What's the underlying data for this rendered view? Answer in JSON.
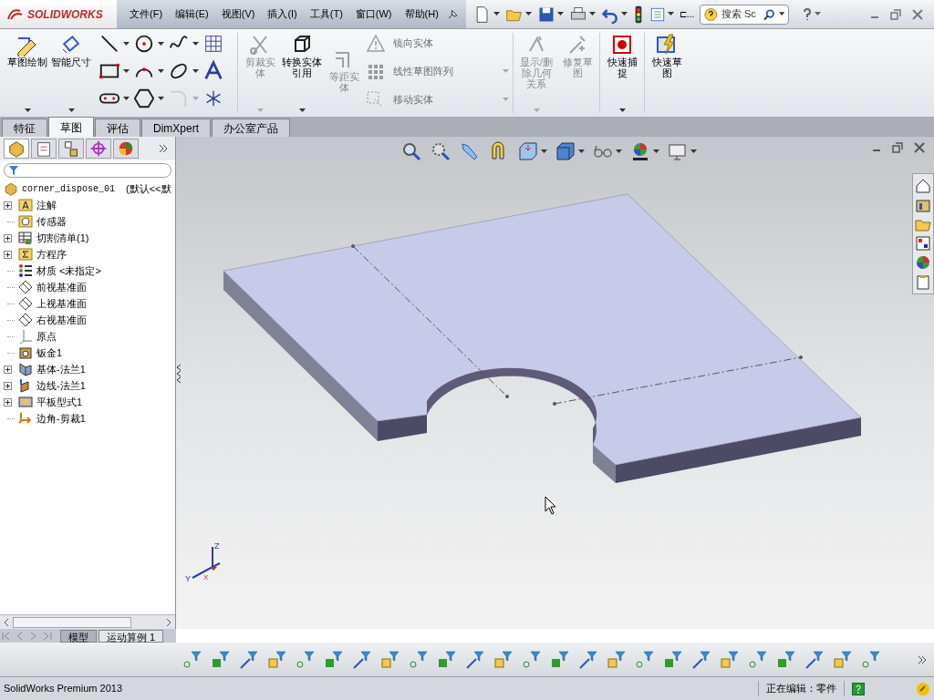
{
  "window": {
    "app_name": "SOLIDWORKS"
  },
  "menu": [
    "文件(F)",
    "编辑(E)",
    "视图(V)",
    "插入(I)",
    "工具(T)",
    "窗口(W)",
    "帮助(H)"
  ],
  "quick_toolbar": {
    "overflow": "⊏..."
  },
  "search": {
    "placeholder": "搜索 Sc"
  },
  "ribbon": {
    "sketch_large": [
      {
        "label": "草图绘制",
        "disabled": false
      },
      {
        "label": "智能尺寸",
        "disabled": false
      }
    ],
    "sketch_tools": [
      {
        "kind": "line",
        "disabled": false
      },
      {
        "kind": "circle",
        "disabled": false
      },
      {
        "kind": "spline",
        "disabled": false
      },
      {
        "kind": "grid",
        "disabled": false
      },
      {
        "kind": "rect",
        "disabled": false
      },
      {
        "kind": "arc",
        "disabled": false
      },
      {
        "kind": "ellipse",
        "disabled": false
      },
      {
        "kind": "text",
        "disabled": false
      },
      {
        "kind": "slot",
        "disabled": false
      },
      {
        "kind": "polygon",
        "disabled": false
      },
      {
        "kind": "fillet",
        "disabled": true
      },
      {
        "kind": "point",
        "disabled": false
      }
    ],
    "edit_large": [
      {
        "label": "剪裁实体",
        "disabled": true
      },
      {
        "label": "转换实体引用",
        "disabled": false
      },
      {
        "label": "等距实体",
        "disabled": true
      }
    ],
    "edit_small": [
      {
        "label": "镜向实体",
        "disabled": true
      },
      {
        "label": "线性草图阵列",
        "disabled": true
      },
      {
        "label": "移动实体",
        "disabled": true
      }
    ],
    "relation_large": [
      {
        "label": "显示/删除几何关系",
        "disabled": true
      },
      {
        "label": "修复草图",
        "disabled": true
      },
      {
        "label": "快速捕捉",
        "disabled": false
      },
      {
        "label": "快速草图",
        "disabled": false
      }
    ]
  },
  "tabs": [
    {
      "label": "特征",
      "selected": false
    },
    {
      "label": "草图",
      "selected": true
    },
    {
      "label": "评估",
      "selected": false
    },
    {
      "label": "DimXpert",
      "selected": false
    },
    {
      "label": "办公室产品",
      "selected": false
    }
  ],
  "feature_tree": {
    "root": {
      "name": "corner_dispose_01",
      "configuration": "(默认<<默"
    },
    "items": [
      {
        "kind": "annotations",
        "label": "注解",
        "expandable": true
      },
      {
        "kind": "sensors",
        "label": "传感器",
        "expandable": false
      },
      {
        "kind": "cutlist",
        "label": "切割清单(1)",
        "expandable": true
      },
      {
        "kind": "equations",
        "label": "方程序",
        "expandable": true
      },
      {
        "kind": "material",
        "label": "材质 <未指定>",
        "expandable": false
      },
      {
        "kind": "plane",
        "label": "前视基准面",
        "expandable": false
      },
      {
        "kind": "plane",
        "label": "上视基准面",
        "expandable": false
      },
      {
        "kind": "plane",
        "label": "右视基准面",
        "expandable": false
      },
      {
        "kind": "origin",
        "label": "原点",
        "expandable": false
      },
      {
        "kind": "sheetmetal",
        "label": "钣金1",
        "expandable": false
      },
      {
        "kind": "baseflange",
        "label": "基体-法兰1",
        "expandable": true
      },
      {
        "kind": "edgeflange",
        "label": "边线-法兰1",
        "expandable": true
      },
      {
        "kind": "flatpattern",
        "label": "平板型式1",
        "expandable": true
      },
      {
        "kind": "cornertrim",
        "label": "边角-剪裁1",
        "expandable": false
      }
    ]
  },
  "triad": {
    "z": "Z",
    "y": "Y",
    "x": "X"
  },
  "model_tabs": [
    {
      "label": "模型",
      "selected": true
    },
    {
      "label": "运动算例 1",
      "selected": false
    }
  ],
  "status_bar": {
    "product": "SolidWorks Premium 2013",
    "editing": "正在编辑：零件"
  }
}
